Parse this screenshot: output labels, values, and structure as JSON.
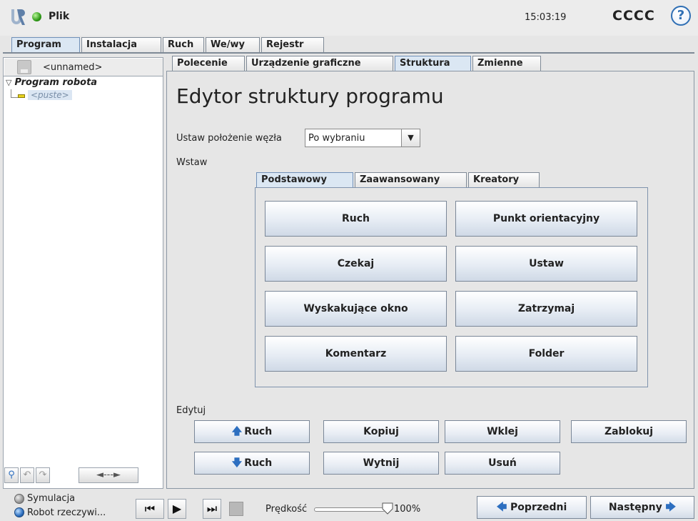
{
  "topbar": {
    "file_label": "Plik",
    "clock": "15:03:19",
    "robot_name": "CCCC",
    "help": "?"
  },
  "main_tabs": [
    "Program",
    "Instalacja",
    "Ruch",
    "We/wy",
    "Rejestr"
  ],
  "left": {
    "program_name": "<unnamed>",
    "tree_root": "Program robota",
    "tree_child": "<puste>",
    "nav_arrow": "◄---►"
  },
  "sub_tabs": [
    "Polecenie",
    "Urządzenie graficzne",
    "Struktura",
    "Zmienne"
  ],
  "editor": {
    "title": "Edytor struktury programu",
    "position_label": "Ustaw położenie węzła",
    "position_value": "Po wybraniu",
    "insert_label": "Wstaw",
    "insert_tabs": [
      "Podstawowy",
      "Zaawansowany",
      "Kreatory"
    ],
    "insert_buttons": [
      "Ruch",
      "Punkt orientacyjny",
      "Czekaj",
      "Ustaw",
      "Wyskakujące okno",
      "Zatrzymaj",
      "Komentarz",
      "Folder"
    ],
    "edit_label": "Edytuj",
    "edit_buttons": {
      "move_up": "Ruch",
      "copy": "Kopiuj",
      "paste": "Wklej",
      "lock": "Zablokuj",
      "move_down": "Ruch",
      "cut": "Wytnij",
      "delete": "Usuń"
    }
  },
  "bottom": {
    "simulation": "Symulacja",
    "real_robot": "Robot rzeczywi...",
    "speed_label": "Prędkość",
    "speed_value": "100%",
    "prev": "Poprzedni",
    "next": "Następny"
  },
  "colors": {
    "accent_blue": "#2d6fc0",
    "status_green": "#2e9a16",
    "tab_active": "#dbe7f3"
  }
}
